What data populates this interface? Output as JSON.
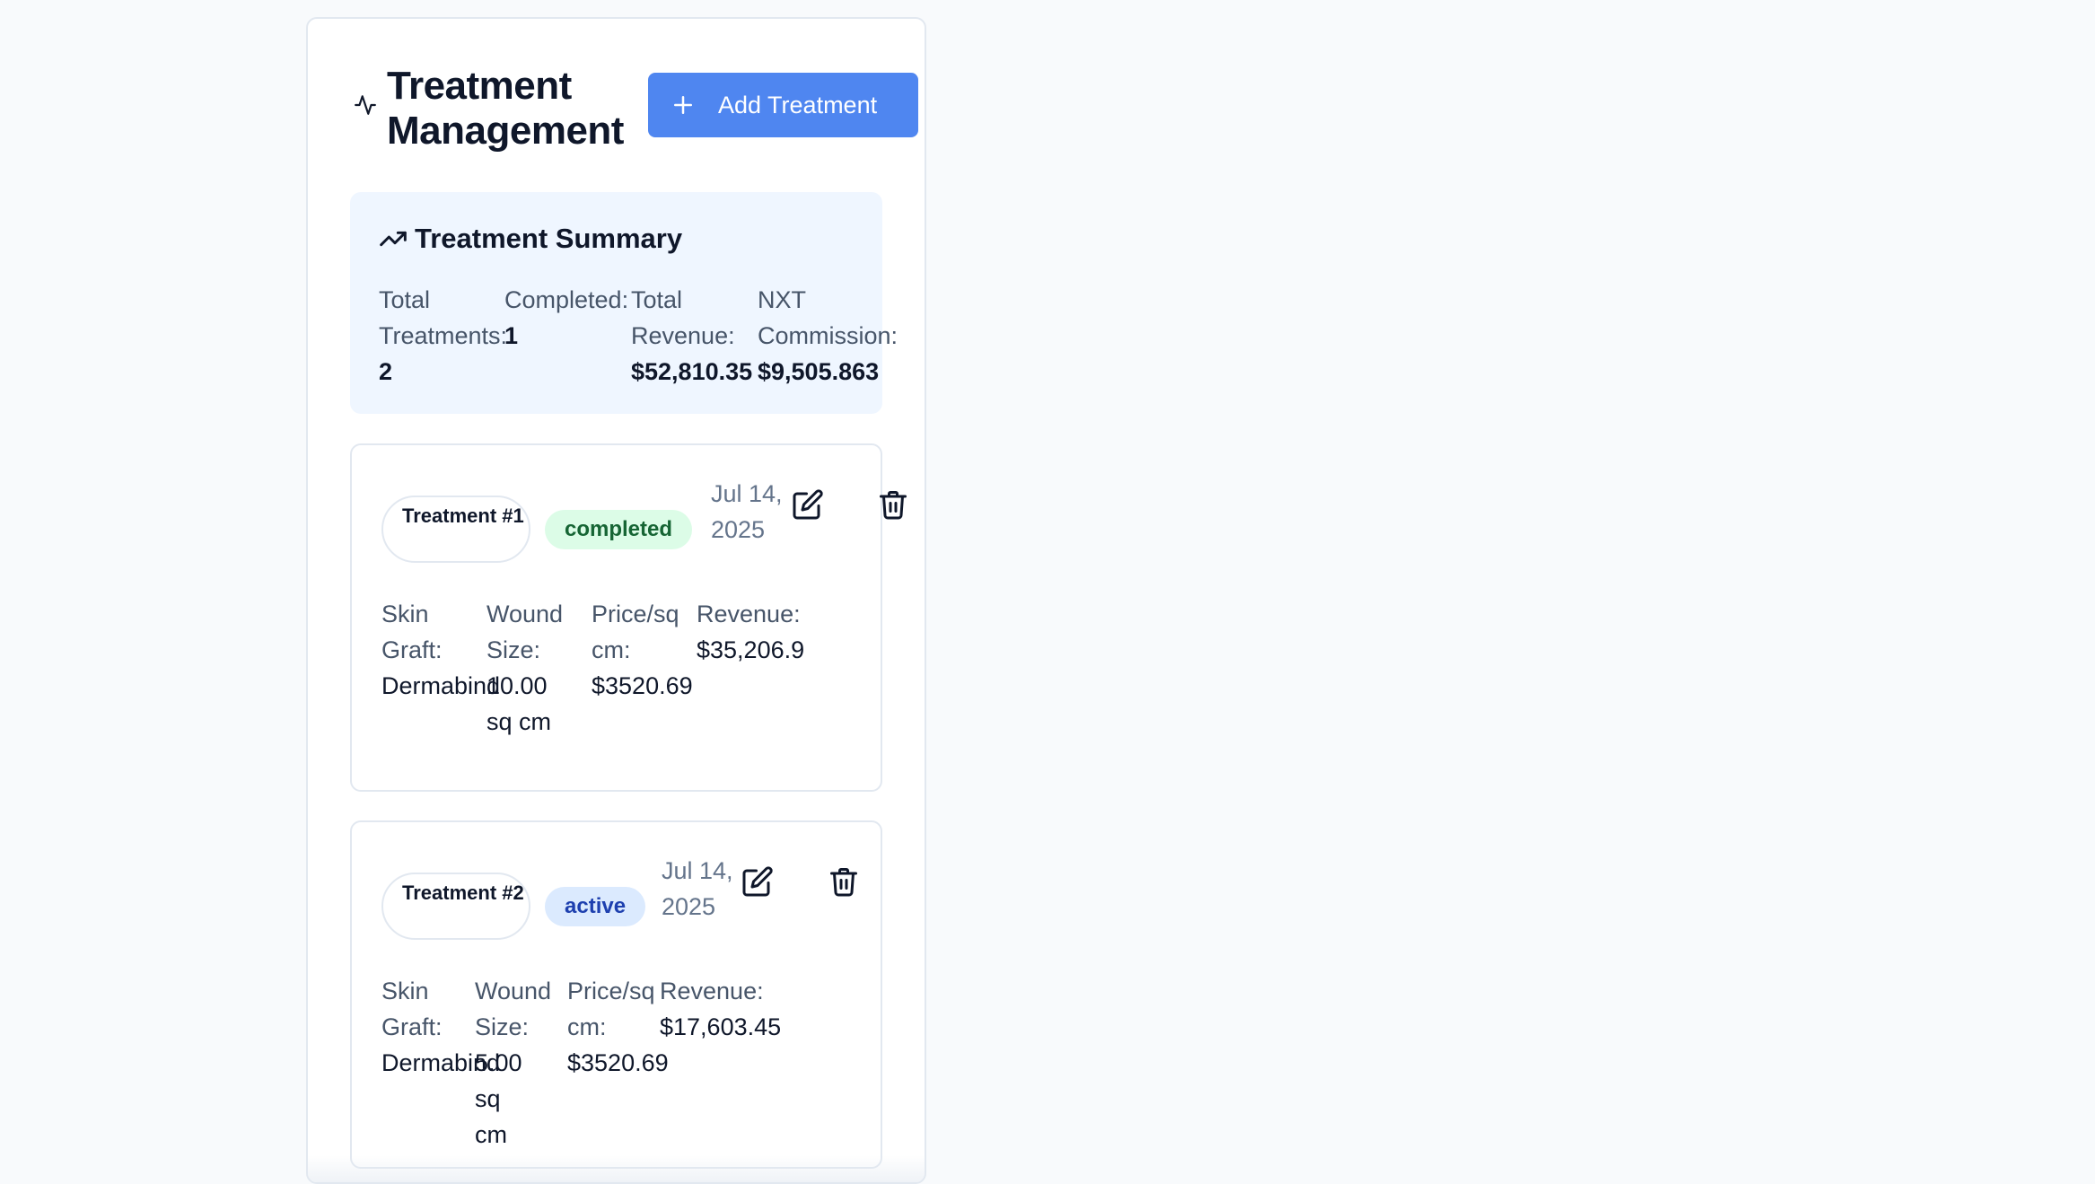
{
  "header": {
    "title": "Treatment Management",
    "title_icon": "activity-icon",
    "add_button_label": "Add Treatment"
  },
  "summary": {
    "heading": "Treatment Summary",
    "icon": "trending-up-icon",
    "stats": [
      {
        "label": "Total Treatments:",
        "value": "2"
      },
      {
        "label": "Completed:",
        "value": "1"
      },
      {
        "label": "Total Revenue:",
        "value": "$52,810.35"
      },
      {
        "label": "NXT Commission:",
        "value": "$9,505.863"
      }
    ]
  },
  "treatments": [
    {
      "id_label": "Treatment #1",
      "status": "completed",
      "date": "Jul 14, 2025",
      "fields": [
        {
          "label": "Skin Graft:",
          "value": "Dermabind"
        },
        {
          "label": "Wound Size:",
          "value": "10.00 sq cm"
        },
        {
          "label": "Price/sq cm:",
          "value": "$3520.69"
        },
        {
          "label": "Revenue:",
          "value": "$35,206.9"
        }
      ]
    },
    {
      "id_label": "Treatment #2",
      "status": "active",
      "date": "Jul 14, 2025",
      "fields": [
        {
          "label": "Skin Graft:",
          "value": "Dermabind"
        },
        {
          "label": "Wound Size:",
          "value": "5.00 sq cm"
        },
        {
          "label": "Price/sq cm:",
          "value": "$3520.69"
        },
        {
          "label": "Revenue:",
          "value": "$17,603.45"
        }
      ]
    }
  ],
  "colors": {
    "accent": "#4f86f0",
    "summary_bg": "#eff6ff",
    "completed_bg": "#dcfce7",
    "completed_text": "#166534",
    "active_bg": "#dbeafe",
    "active_text": "#1e40af"
  }
}
